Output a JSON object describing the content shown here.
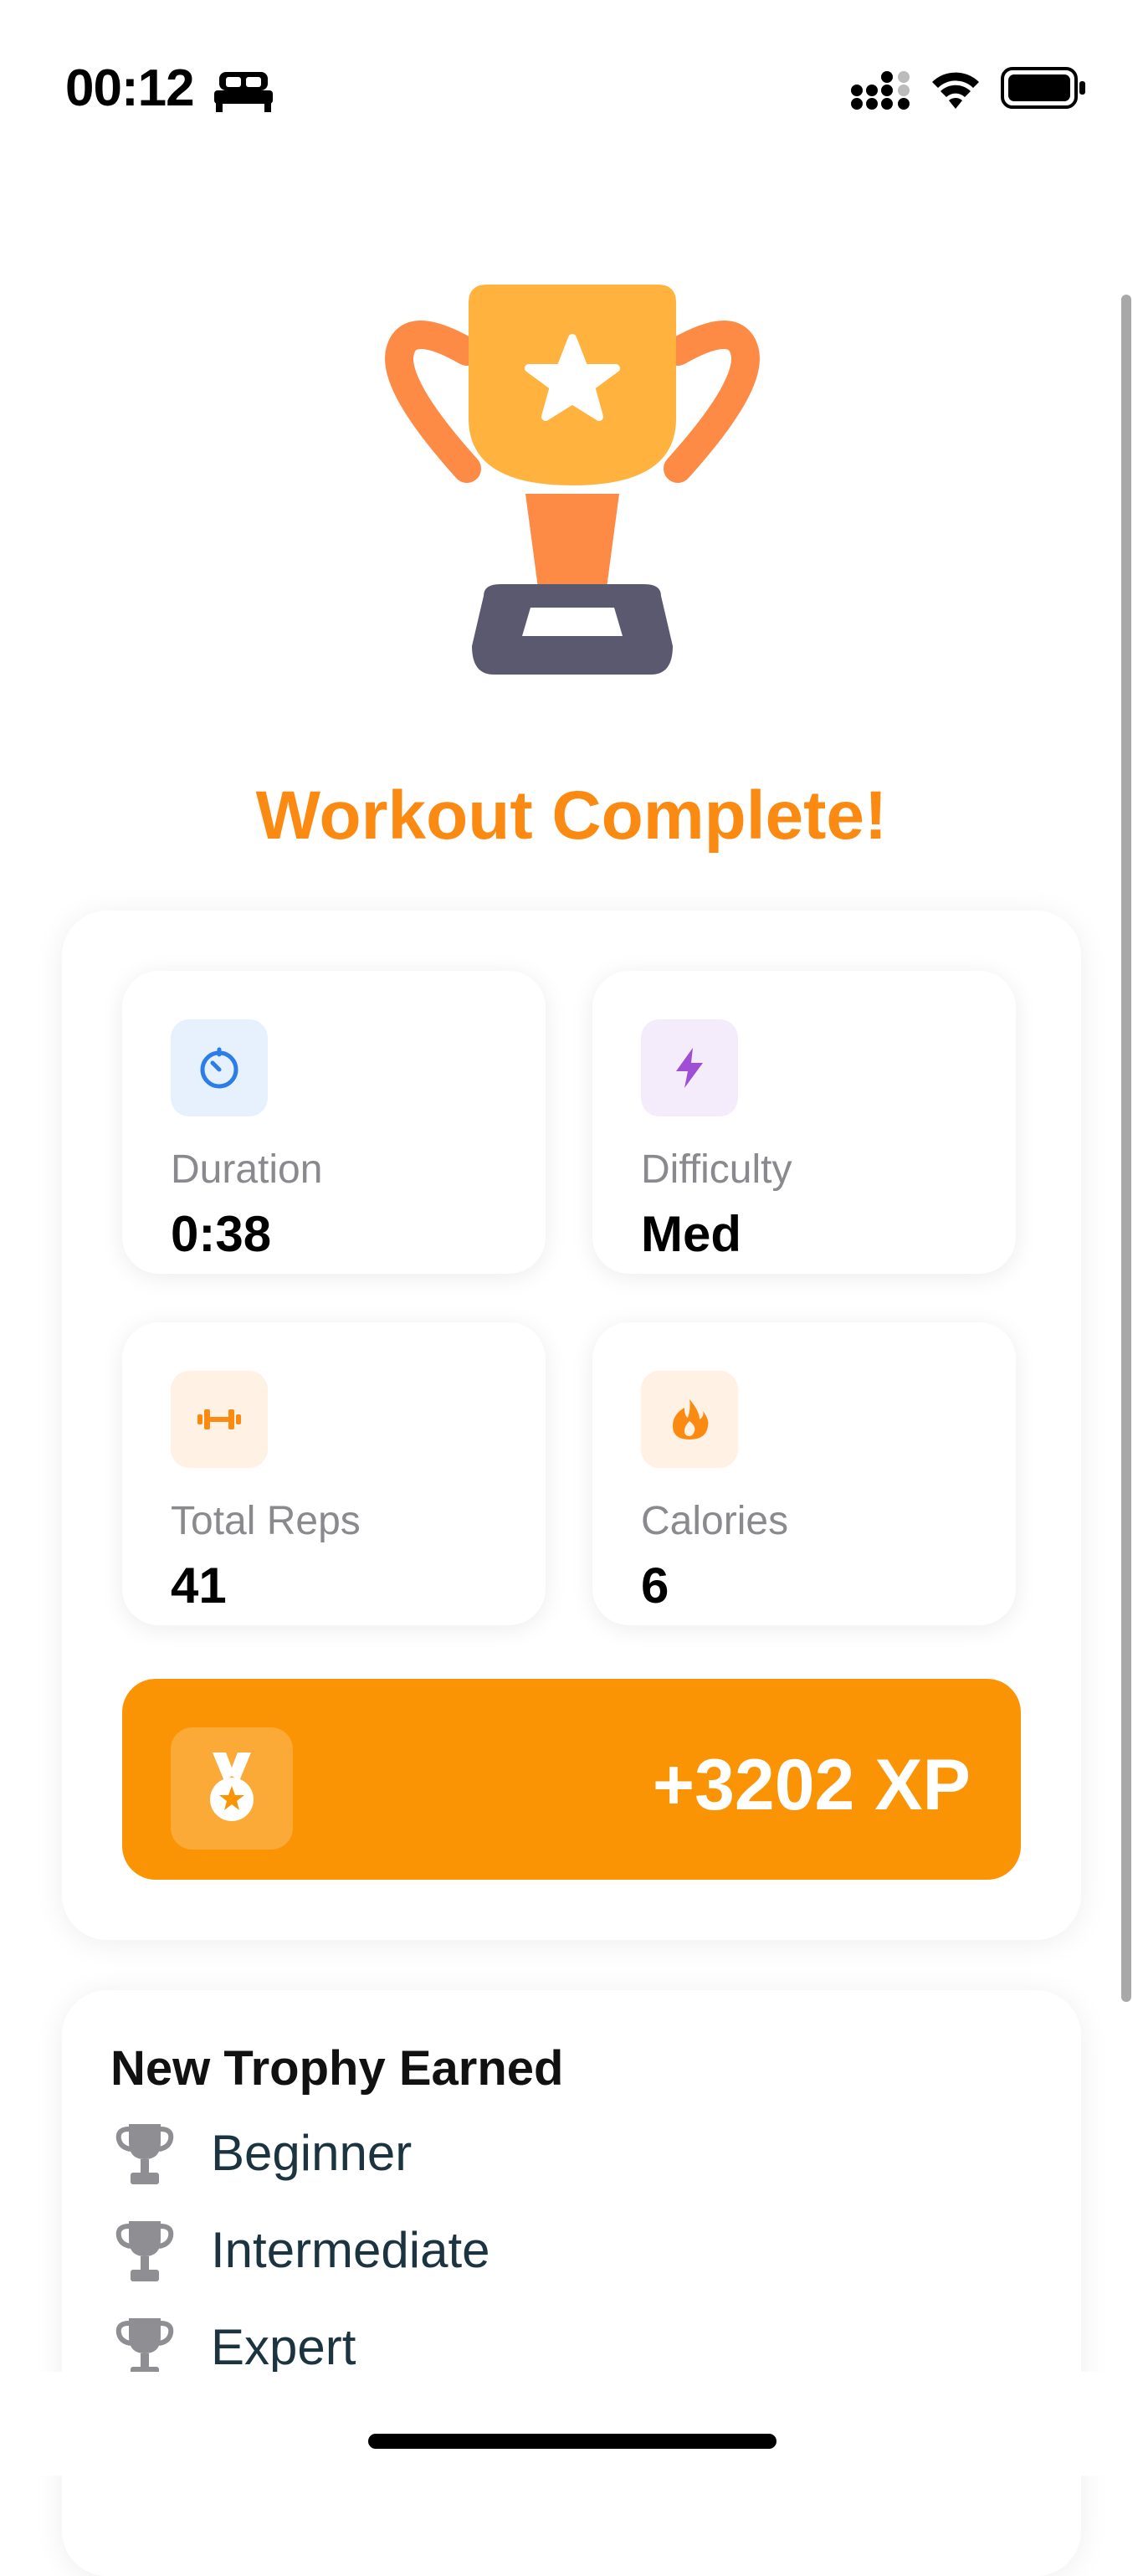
{
  "status_bar": {
    "time": "00:12",
    "icons": [
      "bed-icon",
      "signal-icon",
      "wifi-icon",
      "battery-icon"
    ]
  },
  "header": {
    "title": "Workout Complete!",
    "illustration": "trophy-icon"
  },
  "stats": [
    {
      "label": "Duration",
      "value": "0:38",
      "icon": "stopwatch-icon",
      "color": "#2b7de9",
      "bg": "#e6f1fd"
    },
    {
      "label": "Difficulty",
      "value": "Med",
      "icon": "lightning-icon",
      "color": "#a04ed6",
      "bg": "#f4ebfb"
    },
    {
      "label": "Total Reps",
      "value": "41",
      "icon": "dumbbell-icon",
      "color": "#fb8a12",
      "bg": "#fff2e4"
    },
    {
      "label": "Calories",
      "value": "6",
      "icon": "flame-icon",
      "color": "#fb8a12",
      "bg": "#fff2e4"
    }
  ],
  "xp": {
    "value": "+3202 XP",
    "icon": "medal-icon",
    "color": "#fb9405"
  },
  "trophies": {
    "heading": "New Trophy Earned",
    "items": [
      {
        "label": "Beginner",
        "icon": "trophy-icon"
      },
      {
        "label": "Intermediate",
        "icon": "trophy-icon"
      },
      {
        "label": "Expert",
        "icon": "trophy-icon"
      }
    ]
  },
  "colors": {
    "accent": "#fb8a12",
    "trophy_cup": "#ffb23e",
    "trophy_handles": "#fd8a45",
    "trophy_base": "#5b5970"
  }
}
